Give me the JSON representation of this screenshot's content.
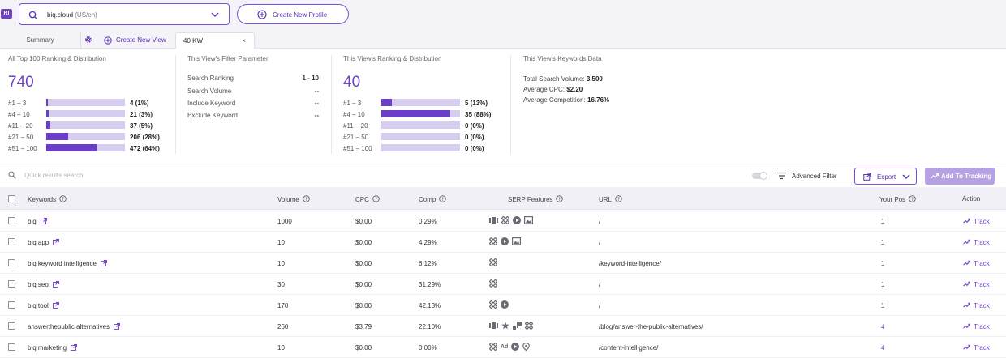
{
  "topbar": {
    "logo_text": "RI",
    "domain": "biq.cloud",
    "region": "(US/en)",
    "create_profile_label": "Create New Profile"
  },
  "tabs": {
    "summary": "Summary",
    "create_view": "Create New View",
    "active": "40 KW",
    "close": "×"
  },
  "stats": {
    "all_top100": {
      "title": "All Top 100 Ranking & Distribution",
      "total": "740",
      "rows": [
        {
          "label": "#1 – 3",
          "value": "4 (1%)",
          "fraction": 0.01
        },
        {
          "label": "#4 – 10",
          "value": "21 (3%)",
          "fraction": 0.03
        },
        {
          "label": "#11 – 20",
          "value": "37 (5%)",
          "fraction": 0.05
        },
        {
          "label": "#21 – 50",
          "value": "206 (28%)",
          "fraction": 0.28
        },
        {
          "label": "#51 – 100",
          "value": "472 (64%)",
          "fraction": 0.64
        }
      ]
    },
    "filter": {
      "title": "This View's Filter Parameter",
      "rows": [
        {
          "label": "Search Ranking",
          "value": "1 - 10"
        },
        {
          "label": "Search Volume",
          "value": "--"
        },
        {
          "label": "Include Keyword",
          "value": "--"
        },
        {
          "label": "Exclude Keyword",
          "value": "--"
        }
      ]
    },
    "view_ranking": {
      "title": "This View's Ranking & Distribution",
      "total": "40",
      "rows": [
        {
          "label": "#1 – 3",
          "value": "5 (13%)",
          "fraction": 0.13
        },
        {
          "label": "#4 – 10",
          "value": "35 (88%)",
          "fraction": 0.88
        },
        {
          "label": "#11 – 20",
          "value": "0 (0%)",
          "fraction": 0
        },
        {
          "label": "#21 – 50",
          "value": "0 (0%)",
          "fraction": 0
        },
        {
          "label": "#51 – 100",
          "value": "0 (0%)",
          "fraction": 0
        }
      ]
    },
    "keywords_data": {
      "title": "This View's Keywords Data",
      "total_volume_label": "Total Search Volume:",
      "total_volume": "3,500",
      "avg_cpc_label": "Average CPC:",
      "avg_cpc": "$2.20",
      "avg_comp_label": "Average Competition:",
      "avg_comp": "16.76%"
    }
  },
  "toolbar": {
    "search_placeholder": "Quick results search",
    "advanced_filter": "Advanced Filter",
    "export_label": "Export",
    "add_tracking_label": "Add To Tracking"
  },
  "table": {
    "headers": {
      "keywords": "Keywords",
      "volume": "Volume",
      "cpc": "CPC",
      "comp": "Comp",
      "serp": "SERP Features",
      "url": "URL",
      "pos": "Your Pos",
      "action": "Action"
    },
    "track_label": "Track",
    "rows": [
      {
        "keyword": "biq",
        "volume": "1000",
        "cpc": "$0.00",
        "comp": "0.29%",
        "serp": [
          "carousel-icon",
          "sitelinks-icon",
          "video-icon",
          "image-icon"
        ],
        "url": "/",
        "pos": "1"
      },
      {
        "keyword": "biq app",
        "volume": "10",
        "cpc": "$0.00",
        "comp": "4.29%",
        "serp": [
          "sitelinks-icon",
          "video-icon",
          "image-icon"
        ],
        "url": "/",
        "pos": "1"
      },
      {
        "keyword": "biq keyword intelligence",
        "volume": "10",
        "cpc": "$0.00",
        "comp": "6.12%",
        "serp": [
          "sitelinks-icon"
        ],
        "url": "/keyword-intelligence/",
        "pos": "1"
      },
      {
        "keyword": "biq seo",
        "volume": "30",
        "cpc": "$0.00",
        "comp": "31.29%",
        "serp": [
          "sitelinks-icon"
        ],
        "url": "/",
        "pos": "1"
      },
      {
        "keyword": "biq tool",
        "volume": "170",
        "cpc": "$0.00",
        "comp": "42.13%",
        "serp": [
          "sitelinks-icon",
          "video-icon"
        ],
        "url": "/",
        "pos": "1"
      },
      {
        "keyword": "answerthepublic alternatives",
        "volume": "260",
        "cpc": "$3.79",
        "comp": "22.10%",
        "serp": [
          "carousel-icon",
          "star-icon",
          "featured-snippet-icon",
          "sitelinks-icon"
        ],
        "url": "/blog/answer-the-public-alternatives/",
        "pos": "4"
      },
      {
        "keyword": "biq marketing",
        "volume": "10",
        "cpc": "$0.00",
        "comp": "0.00%",
        "serp": [
          "sitelinks-icon",
          "ad-icon",
          "video-icon",
          "location-icon"
        ],
        "url": "/content-intelligence/",
        "pos": "4"
      }
    ]
  },
  "colors": {
    "accent": "#6f42c1",
    "bar_track": "#d7cdef",
    "bar_fill": "#6a3ec8",
    "button_disabled": "#b6a2e2"
  }
}
